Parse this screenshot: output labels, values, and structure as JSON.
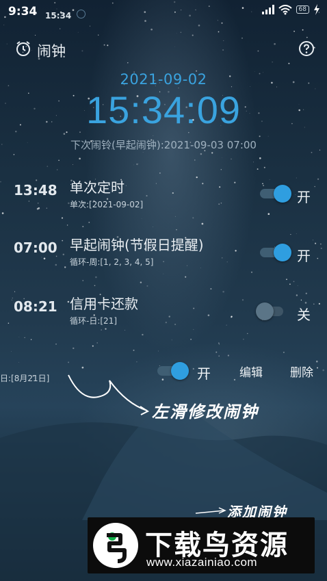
{
  "status_bar": {
    "time": "9:34",
    "secondary_time": "15:34",
    "battery": "68"
  },
  "appbar": {
    "title": "闹钟"
  },
  "clock": {
    "date": "2021-09-02",
    "time": "15:34:09",
    "next_alarm": "下次闹铃(早起闹钟):2021-09-03 07:00"
  },
  "alarms": [
    {
      "time": "13:48",
      "title": "单次定时",
      "sub": "单次:[2021-09-02]",
      "state_label": "开",
      "on": true
    },
    {
      "time": "07:00",
      "title": "早起闹钟(节假日提醒)",
      "sub": "循环-周:[1, 2, 3, 4, 5]",
      "state_label": "开",
      "on": true
    },
    {
      "time": "08:21",
      "title": "信用卡还款",
      "sub": "循环-日:[21]",
      "state_label": "关",
      "on": false
    }
  ],
  "swiped_row": {
    "sub": "日:[8月21日]",
    "state_label": "开",
    "on": true,
    "edit_label": "编辑",
    "delete_label": "删除"
  },
  "hints": {
    "swipe": "左滑修改闹钟",
    "add": "添加闹钟"
  },
  "watermark": {
    "title": "下载鸟资源",
    "url": "www.xiazainiao.com"
  },
  "colors": {
    "accent": "#3aa3df",
    "toggle_on": "#2f9ee0",
    "toggle_off": "#5b7587"
  }
}
